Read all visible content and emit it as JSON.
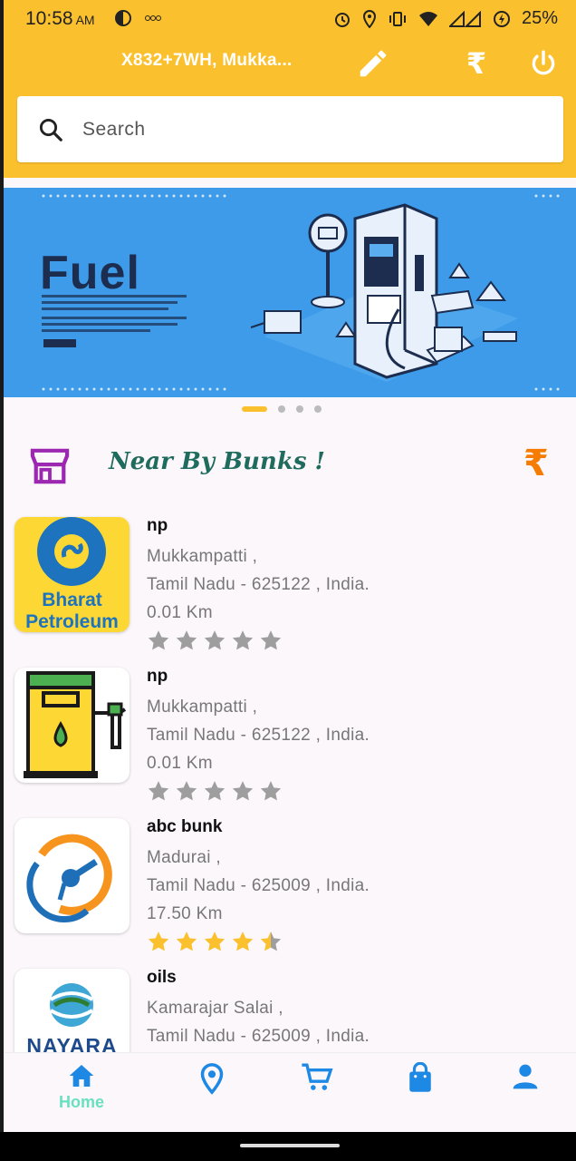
{
  "status": {
    "time": "10:58",
    "ampm": "AM",
    "battery": "25%"
  },
  "header": {
    "location": "X832+7WH, Mukka...",
    "icons": [
      "edit-icon",
      "rupee-icon",
      "power-icon"
    ]
  },
  "search": {
    "placeholder": "Search"
  },
  "banner": {
    "title": "Fuel",
    "slide_index": 1,
    "slide_count": 4
  },
  "section": {
    "title": "Near By Bunks !",
    "rupee": "₹"
  },
  "bunks": [
    {
      "name": "np",
      "area": "Mukkampatti ,",
      "region": "Tamil Nadu - 625122 , India.",
      "distance": "0.01 Km",
      "rating": 0,
      "logo": "bharat-petroleum-logo",
      "logo_text": [
        "Bharat",
        "Petroleum"
      ]
    },
    {
      "name": "np",
      "area": "Mukkampatti ,",
      "region": "Tamil Nadu - 625122 , India.",
      "distance": "0.01 Km",
      "rating": 0,
      "logo": "fuel-pump-logo"
    },
    {
      "name": "abc bunk",
      "area": "Madurai ,",
      "region": "Tamil Nadu - 625009 , India.",
      "distance": "17.50 Km",
      "rating": 4.5,
      "logo": "fuel-nozzle-logo"
    },
    {
      "name": "oils",
      "area": "Kamarajar Salai ,",
      "region": "Tamil Nadu - 625009 , India.",
      "distance": "",
      "rating": 0,
      "logo": "nayara-logo",
      "logo_text": [
        "NAYARA"
      ]
    }
  ],
  "nav": {
    "home_label": "Home",
    "items": [
      "home-icon",
      "location-pin-icon",
      "cart-icon",
      "shopping-bag-icon",
      "person-icon"
    ]
  },
  "colors": {
    "primary": "#fbc02d",
    "banner": "#3d9be9",
    "nav_active": "#69e0c0",
    "nav_icon": "#1e88e5",
    "star_filled": "#fbc02d",
    "star_empty": "#9e9e9e",
    "title_green": "#1f6b5d",
    "store_purple": "#9c27b0"
  }
}
